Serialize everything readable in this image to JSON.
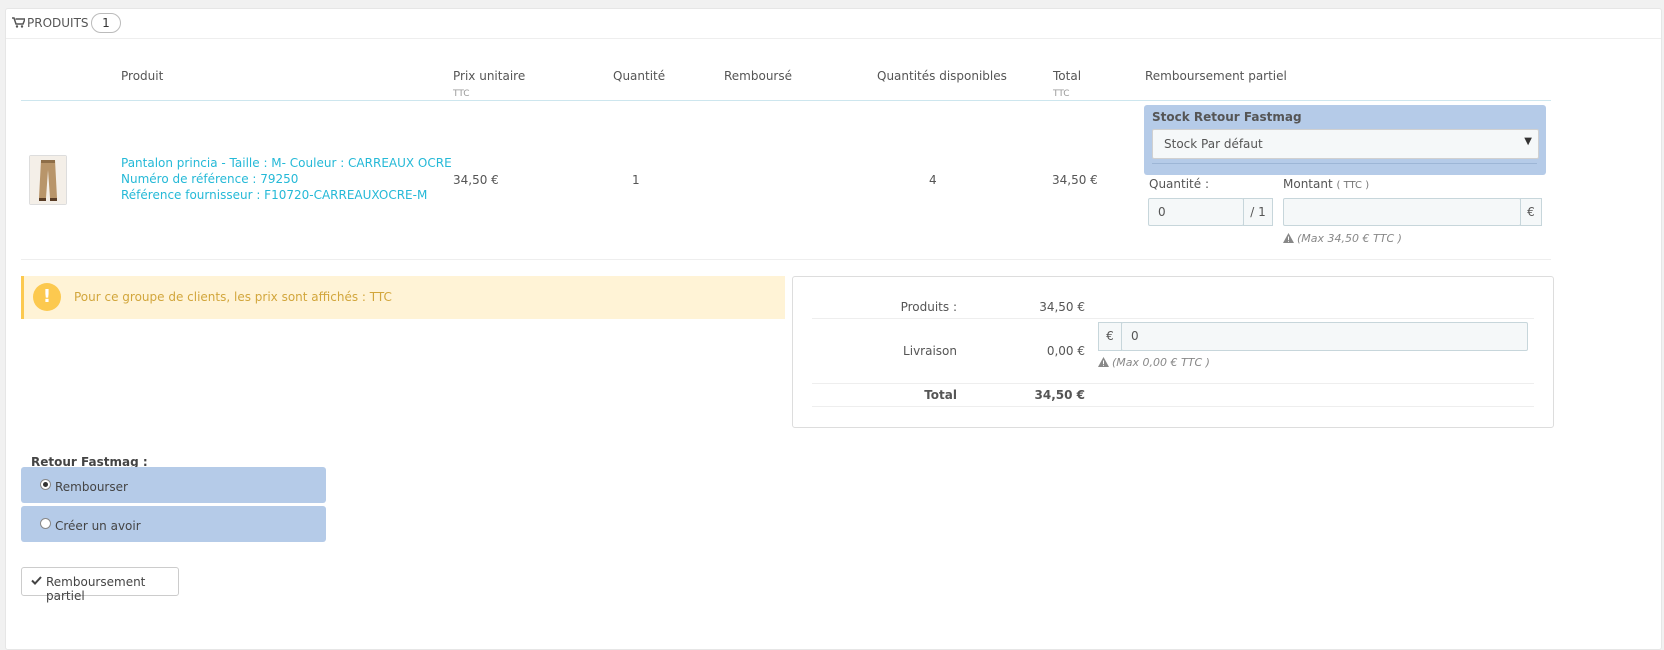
{
  "panel": {
    "title": "Produits",
    "count": "1"
  },
  "table": {
    "headers": {
      "product": "Produit",
      "unit_price": "Prix unitaire",
      "unit_price_sub": "TTC",
      "quantity": "Quantité",
      "refunded": "Remboursé",
      "available": "Quantités disponibles",
      "total": "Total",
      "total_sub": "TTC",
      "partial_refund": "Remboursement partiel"
    },
    "row": {
      "name": "Pantalon princia - Taille : M- Couleur : CARREAUX OCRE",
      "reference": "Numéro de référence : 79250",
      "supplier_ref": "Référence fournisseur : F10720-CARREAUXOCRE-M",
      "unit_price": "34,50 €",
      "quantity": "1",
      "available": "4",
      "total": "34,50 €",
      "stock_label": "Stock Retour Fastmag",
      "stock_selected": "Stock Par défaut",
      "qty_label": "Quantité :",
      "qty_value": "0",
      "qty_max": "/ 1",
      "amount_label": "Montant",
      "amount_sub": "( TTC )",
      "amount_value": "",
      "amount_currency": "€",
      "amount_help": "(Max 34,50 € TTC )"
    }
  },
  "alert": {
    "text": "Pour ce groupe de clients, les prix sont affichés : TTC"
  },
  "totals": {
    "products_label": "Produits :",
    "products_value": "34,50 €",
    "shipping_label": "Livraison",
    "shipping_value": "0,00 €",
    "shipping_currency": "€",
    "shipping_input": "0",
    "shipping_help": "(Max 0,00 € TTC )",
    "total_label": "Total",
    "total_value": "34,50 €"
  },
  "retour": {
    "label": "Retour Fastmag :",
    "options": [
      "Rembourser",
      "Créer un avoir"
    ],
    "selected": "Rembourser"
  },
  "submit": {
    "label": "Remboursement partiel"
  },
  "colors": {
    "link": "#25b9d7",
    "highlight_box": "#b5cbe8",
    "alert_bg": "#fff3d6",
    "alert_accent": "#fcc94f"
  }
}
